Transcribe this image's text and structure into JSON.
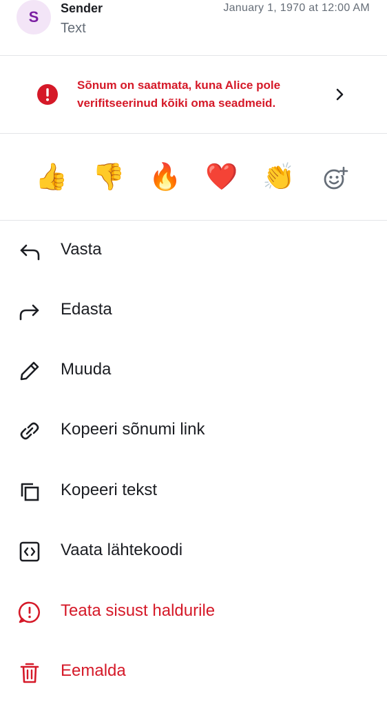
{
  "header": {
    "avatar_letter": "S",
    "sender": "Sender",
    "preview": "Text",
    "timestamp": "January 1, 1970 at 12:00 AM"
  },
  "warning": {
    "text": "Sõnum on saatmata, kuna Alice pole verifitseerinud kõiki oma seadmeid.",
    "icon": "error-icon",
    "color": "#d51928"
  },
  "reactions": {
    "items": [
      {
        "emoji": "👍",
        "name": "thumbs-up"
      },
      {
        "emoji": "👎",
        "name": "thumbs-down"
      },
      {
        "emoji": "🔥",
        "name": "fire"
      },
      {
        "emoji": "❤️",
        "name": "heart"
      },
      {
        "emoji": "👏",
        "name": "clapping-hands"
      }
    ],
    "more_icon": "add-reaction-icon"
  },
  "menu": {
    "items": [
      {
        "label": "Vasta",
        "icon": "reply-icon"
      },
      {
        "label": "Edasta",
        "icon": "forward-icon"
      },
      {
        "label": "Muuda",
        "icon": "pencil-icon"
      },
      {
        "label": "Kopeeri sõnumi link",
        "icon": "link-icon"
      },
      {
        "label": "Kopeeri tekst",
        "icon": "copy-icon"
      },
      {
        "label": "Vaata lähtekoodi",
        "icon": "code-icon"
      },
      {
        "label": "Teata sisust haldurile",
        "icon": "report-icon"
      },
      {
        "label": "Eemalda",
        "icon": "trash-icon"
      }
    ]
  },
  "colors": {
    "danger": "#d51928",
    "text": "#1b1d22",
    "secondary": "#656d77",
    "avatar_bg": "#f3e5f7",
    "avatar_fg": "#7b1fa2"
  }
}
